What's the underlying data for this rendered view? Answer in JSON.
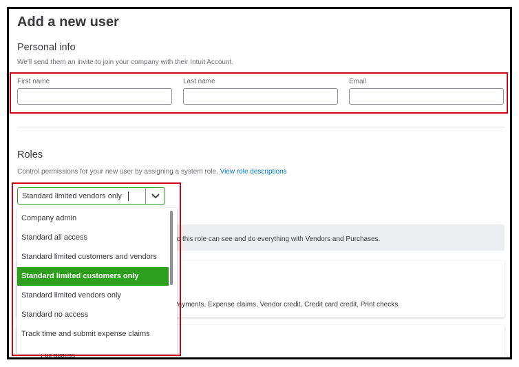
{
  "page": {
    "title": "Add a new user"
  },
  "personal_info": {
    "heading": "Personal info",
    "subtext": "We'll send them an invite to join your company with their Intuit Account.",
    "fields": [
      {
        "label": "First name",
        "value": ""
      },
      {
        "label": "Last name",
        "value": ""
      },
      {
        "label": "Email",
        "value": ""
      }
    ]
  },
  "roles": {
    "heading": "Roles",
    "subtext": "Control permissions for your new user by assigning a system role.",
    "link": "View role descriptions",
    "selected_value": "Standard limited vendors only",
    "options": [
      "Company admin",
      "Standard all access",
      "Standard limited customers and vendors",
      "Standard limited customers only",
      "Standard limited vendors only",
      "Standard no access",
      "Track time and submit expense claims"
    ],
    "highlighted_option": "Standard limited customers only",
    "info_text": "ed to this role can see and do everything with Vendors and Purchases.",
    "card_text": "Payments, Expense claims, Vendor credit, Credit card credit, Print checks",
    "partial_text": "Full access"
  },
  "colors": {
    "accent": "#2ca01c",
    "link": "#0077c5",
    "annotation": "#d0021b"
  },
  "icons": {
    "dropdown": "chevron-down-icon"
  }
}
